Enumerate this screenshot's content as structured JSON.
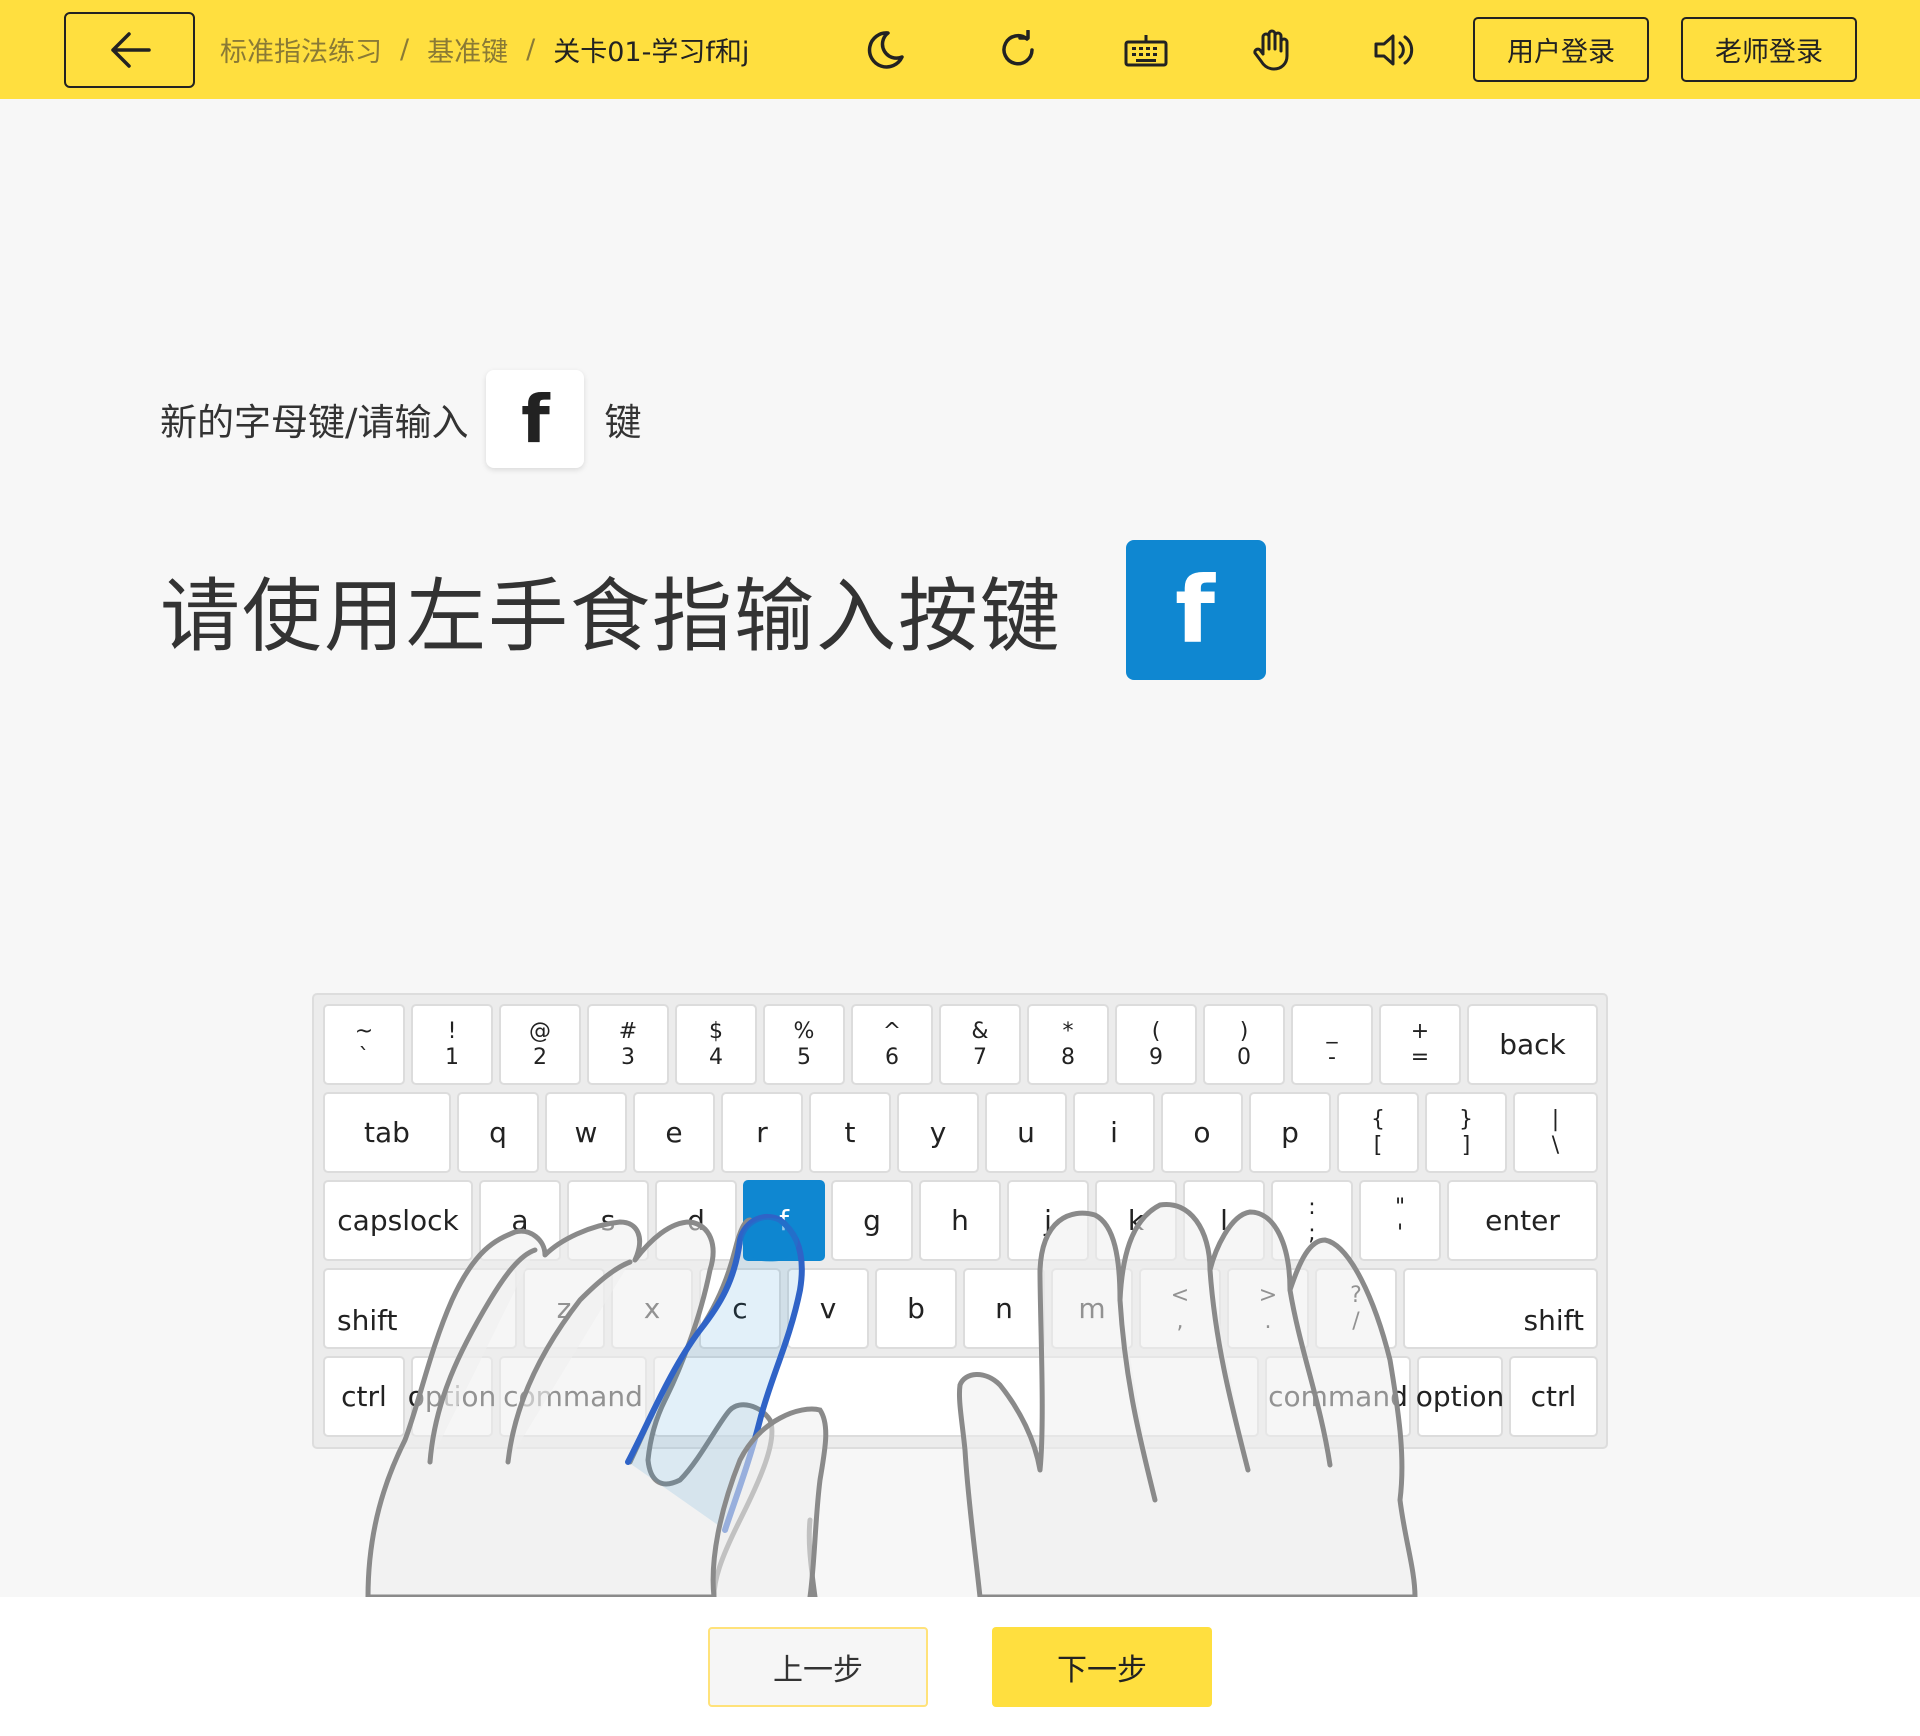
{
  "header": {
    "breadcrumb": [
      "标准指法练习",
      "基准键",
      "关卡01-学习f和j"
    ],
    "separator": "/",
    "icons": [
      "back-arrow-icon",
      "moon-icon",
      "refresh-icon",
      "keyboard-icon",
      "hand-icon",
      "speaker-icon"
    ],
    "user_login": "用户登录",
    "teacher_login": "老师登录",
    "accent_color": "#ffdf3f"
  },
  "instruction": {
    "hint_prefix": "新的字母键/请输入",
    "hint_key": "f",
    "hint_suffix": "键",
    "main_text": "请使用左手食指输入按键",
    "target_key": "f",
    "highlight_color": "#0f87d1"
  },
  "keyboard": {
    "row1": [
      {
        "top": "~",
        "bottom": "`"
      },
      {
        "top": "!",
        "bottom": "1"
      },
      {
        "top": "@",
        "bottom": "2"
      },
      {
        "top": "#",
        "bottom": "3"
      },
      {
        "top": "$",
        "bottom": "4"
      },
      {
        "top": "%",
        "bottom": "5"
      },
      {
        "top": "^",
        "bottom": "6"
      },
      {
        "top": "&",
        "bottom": "7"
      },
      {
        "top": "*",
        "bottom": "8"
      },
      {
        "top": "(",
        "bottom": "9"
      },
      {
        "top": ")",
        "bottom": "0"
      },
      {
        "top": "_",
        "bottom": "-"
      },
      {
        "top": "+",
        "bottom": "="
      },
      {
        "label": "back"
      }
    ],
    "row2": [
      {
        "label": "tab"
      },
      {
        "label": "q"
      },
      {
        "label": "w"
      },
      {
        "label": "e"
      },
      {
        "label": "r"
      },
      {
        "label": "t"
      },
      {
        "label": "y"
      },
      {
        "label": "u"
      },
      {
        "label": "i"
      },
      {
        "label": "o"
      },
      {
        "label": "p"
      },
      {
        "top": "{",
        "bottom": "["
      },
      {
        "top": "}",
        "bottom": "]"
      },
      {
        "top": "|",
        "bottom": "\\"
      }
    ],
    "row3": [
      {
        "label": "capslock"
      },
      {
        "label": "a"
      },
      {
        "label": "s"
      },
      {
        "label": "d"
      },
      {
        "label": "f"
      },
      {
        "label": "g"
      },
      {
        "label": "h"
      },
      {
        "label": "j"
      },
      {
        "label": "k"
      },
      {
        "label": "l"
      },
      {
        "top": ":",
        "bottom": ";"
      },
      {
        "top": "\"",
        "bottom": "'"
      },
      {
        "label": "enter"
      }
    ],
    "row4": [
      {
        "label": "shift"
      },
      {
        "label": "z"
      },
      {
        "label": "x"
      },
      {
        "label": "c"
      },
      {
        "label": "v"
      },
      {
        "label": "b"
      },
      {
        "label": "n"
      },
      {
        "label": "m"
      },
      {
        "top": "<",
        "bottom": ","
      },
      {
        "top": ">",
        "bottom": "."
      },
      {
        "top": "?",
        "bottom": "/"
      },
      {
        "label": "shift"
      }
    ],
    "row5": [
      {
        "label": "ctrl"
      },
      {
        "label": "option"
      },
      {
        "label": "command"
      },
      {
        "label": ""
      },
      {
        "label": "command"
      },
      {
        "label": "option"
      },
      {
        "label": "ctrl"
      }
    ],
    "active_key": "f"
  },
  "footer": {
    "prev_label": "上一步",
    "next_label": "下一步"
  }
}
